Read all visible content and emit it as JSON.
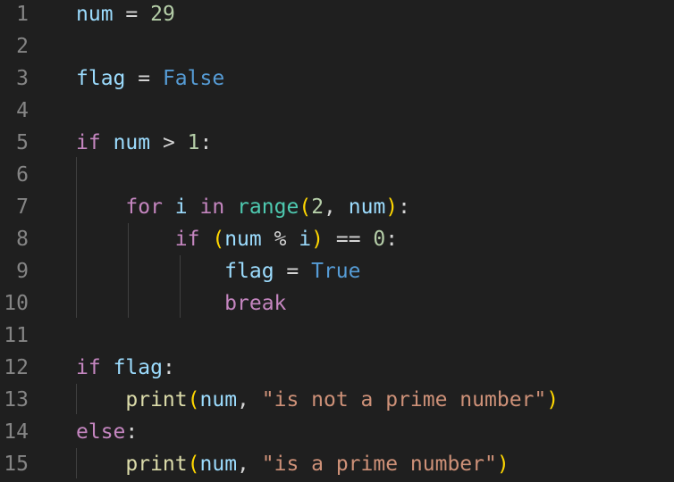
{
  "editor": {
    "lines": [
      {
        "number": "1",
        "tokens": [
          {
            "t": "num",
            "c": "var"
          },
          {
            "t": " = ",
            "c": "pn"
          },
          {
            "t": "29",
            "c": "num"
          }
        ]
      },
      {
        "number": "2",
        "tokens": []
      },
      {
        "number": "3",
        "tokens": [
          {
            "t": "flag",
            "c": "var"
          },
          {
            "t": " = ",
            "c": "pn"
          },
          {
            "t": "False",
            "c": "bool"
          }
        ]
      },
      {
        "number": "4",
        "tokens": []
      },
      {
        "number": "5",
        "tokens": [
          {
            "t": "if",
            "c": "kw"
          },
          {
            "t": " ",
            "c": "pn"
          },
          {
            "t": "num",
            "c": "var"
          },
          {
            "t": " > ",
            "c": "pn"
          },
          {
            "t": "1",
            "c": "num"
          },
          {
            "t": ":",
            "c": "pn"
          }
        ]
      },
      {
        "number": "6",
        "tokens": []
      },
      {
        "number": "7",
        "tokens": [
          {
            "t": "    ",
            "c": "pn"
          },
          {
            "t": "for",
            "c": "kw"
          },
          {
            "t": " ",
            "c": "pn"
          },
          {
            "t": "i",
            "c": "var"
          },
          {
            "t": " ",
            "c": "pn"
          },
          {
            "t": "in",
            "c": "kw"
          },
          {
            "t": " ",
            "c": "pn"
          },
          {
            "t": "range",
            "c": "bi"
          },
          {
            "t": "(",
            "c": "br1"
          },
          {
            "t": "2",
            "c": "num"
          },
          {
            "t": ", ",
            "c": "pn"
          },
          {
            "t": "num",
            "c": "var"
          },
          {
            "t": ")",
            "c": "br1"
          },
          {
            "t": ":",
            "c": "pn"
          }
        ]
      },
      {
        "number": "8",
        "tokens": [
          {
            "t": "        ",
            "c": "pn"
          },
          {
            "t": "if",
            "c": "kw"
          },
          {
            "t": " ",
            "c": "pn"
          },
          {
            "t": "(",
            "c": "br1"
          },
          {
            "t": "num",
            "c": "var"
          },
          {
            "t": " % ",
            "c": "pn"
          },
          {
            "t": "i",
            "c": "var"
          },
          {
            "t": ")",
            "c": "br1"
          },
          {
            "t": " == ",
            "c": "pn"
          },
          {
            "t": "0",
            "c": "num"
          },
          {
            "t": ":",
            "c": "pn"
          }
        ]
      },
      {
        "number": "9",
        "tokens": [
          {
            "t": "            ",
            "c": "pn"
          },
          {
            "t": "flag",
            "c": "var"
          },
          {
            "t": " = ",
            "c": "pn"
          },
          {
            "t": "True",
            "c": "bool"
          }
        ]
      },
      {
        "number": "10",
        "tokens": [
          {
            "t": "            ",
            "c": "pn"
          },
          {
            "t": "break",
            "c": "kw"
          }
        ]
      },
      {
        "number": "11",
        "tokens": []
      },
      {
        "number": "12",
        "tokens": [
          {
            "t": "if",
            "c": "kw"
          },
          {
            "t": " ",
            "c": "pn"
          },
          {
            "t": "flag",
            "c": "var"
          },
          {
            "t": ":",
            "c": "pn"
          }
        ]
      },
      {
        "number": "13",
        "tokens": [
          {
            "t": "    ",
            "c": "pn"
          },
          {
            "t": "print",
            "c": "fn"
          },
          {
            "t": "(",
            "c": "br1"
          },
          {
            "t": "num",
            "c": "var"
          },
          {
            "t": ", ",
            "c": "pn"
          },
          {
            "t": "\"is not a prime number\"",
            "c": "str"
          },
          {
            "t": ")",
            "c": "br1"
          }
        ]
      },
      {
        "number": "14",
        "tokens": [
          {
            "t": "else",
            "c": "kw"
          },
          {
            "t": ":",
            "c": "pn"
          }
        ]
      },
      {
        "number": "15",
        "tokens": [
          {
            "t": "    ",
            "c": "pn"
          },
          {
            "t": "print",
            "c": "fn"
          },
          {
            "t": "(",
            "c": "br1"
          },
          {
            "t": "num",
            "c": "var"
          },
          {
            "t": ", ",
            "c": "pn"
          },
          {
            "t": "\"is a prime number\"",
            "c": "str"
          },
          {
            "t": ")",
            "c": "br1"
          }
        ]
      }
    ]
  },
  "colors": {
    "background": "#1f1f1f",
    "line_number": "#858585",
    "keyword": "#c586c0",
    "variable": "#9cdcfe",
    "number": "#b5cea8",
    "constant": "#569cd6",
    "function": "#dcdcaa",
    "builtin": "#4ec9b0",
    "string": "#ce9178",
    "bracket": "#ffd700",
    "indent_guide": "#404040"
  }
}
